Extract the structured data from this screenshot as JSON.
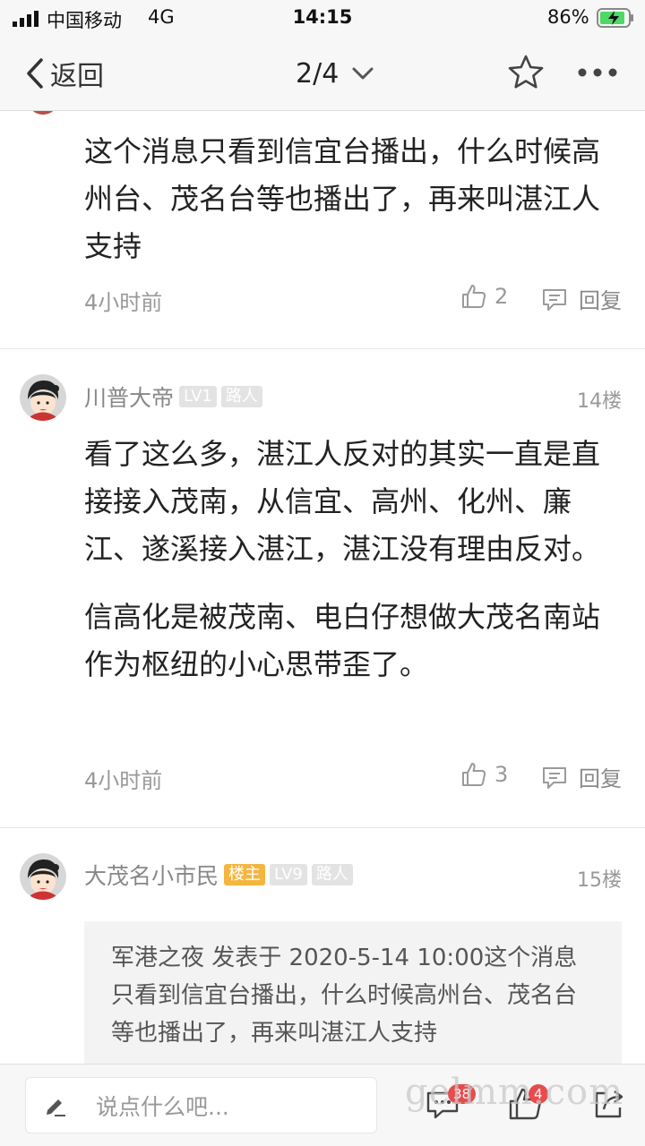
{
  "status_bar": {
    "carrier": "中国移动",
    "network": "4G",
    "time": "14:15",
    "battery": "86%"
  },
  "nav": {
    "back_label": "返回",
    "page": "2/4"
  },
  "posts": [
    {
      "body": [
        "这个消息只看到信宜台播出，什么时候高州台、茂名台等也播出了，再来叫湛江人支持"
      ],
      "time": "4小时前",
      "likes": "2",
      "reply_label": "回复"
    },
    {
      "author": "川普大帝",
      "level": "LV1",
      "role": "路人",
      "floor": "14楼",
      "body": [
        "看了这么多，湛江人反对的其实一直是直接接入茂南，从信宜、高州、化州、廉江、遂溪接入湛江，湛江没有理由反对。",
        "信高化是被茂南、电白仔想做大茂名南站作为枢纽的小心思带歪了。"
      ],
      "time": "4小时前",
      "likes": "3",
      "reply_label": "回复"
    },
    {
      "author": "大茂名小市民",
      "owner_badge": "楼主",
      "level": "LV9",
      "role": "路人",
      "floor": "15楼",
      "quote": "军港之夜 发表于 2020-5-14 10:00这个消息只看到信宜台播出，什么时候高州台、茂名台等也播出了，再来叫湛江人支持"
    }
  ],
  "bottom_bar": {
    "input_placeholder": "说点什么吧...",
    "comment_count": "38",
    "like_count": "4",
    "watermark": "gelmm.com"
  },
  "colors": {
    "bar_bg": "#f7f7f7",
    "owner_badge": "#f4b63f",
    "notify_badge": "#e74c4c"
  },
  "icons": [
    "signal-icon",
    "battery-charging-icon",
    "back-chevron-icon",
    "chevron-down-icon",
    "star-icon",
    "more-icon",
    "thumb-up-icon",
    "reply-bubble-icon",
    "pencil-icon",
    "comment-icon",
    "share-icon"
  ]
}
